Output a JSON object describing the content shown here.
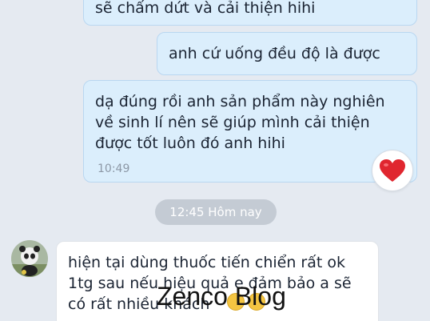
{
  "messages": [
    {
      "direction": "outgoing",
      "text": "sẽ  chấm dứt và cải thiện hihi"
    },
    {
      "direction": "outgoing",
      "text": "anh cứ uống đều độ   là được"
    },
    {
      "direction": "outgoing",
      "text": "dạ đúng rồi anh sản phẩm này  nghiên\nvề sinh lí  nên sẽ giúp mình cải thiện\nđược tốt luôn đó anh hihi",
      "time": "10:49",
      "reaction": "heart-icon"
    },
    {
      "direction": "incoming",
      "text": "hiện tại dùng thuốc tiến chiển rất ok\n1tg sau nếu hiệu quả e đảm bảo a sẽ\ncó rất nhiều khách"
    }
  ],
  "date_separator": "12:45 Hôm nay",
  "watermark": "Zenco Blog",
  "colors": {
    "background": "#e5eaf1",
    "outgoing_bubble": "#dbeefc",
    "incoming_bubble": "#ffffff",
    "heart": "#e0262f"
  }
}
